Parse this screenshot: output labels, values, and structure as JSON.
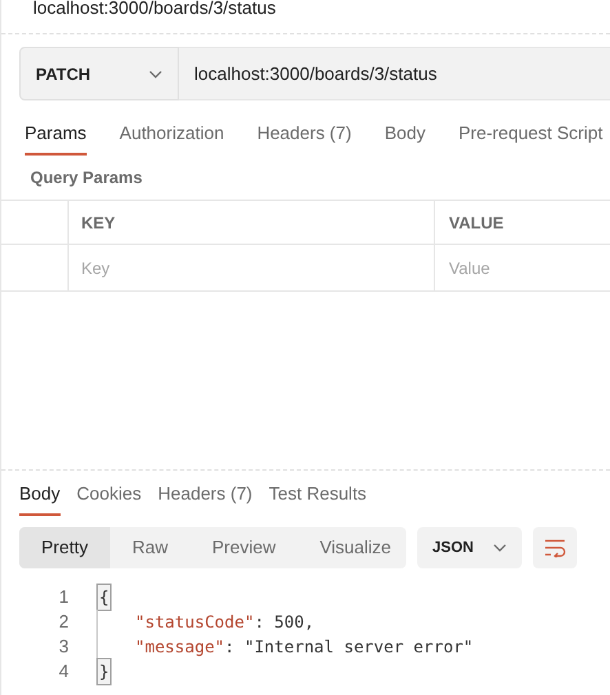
{
  "title": "localhost:3000/boards/3/status",
  "request": {
    "method": "PATCH",
    "url": "localhost:3000/boards/3/status"
  },
  "request_tabs": [
    {
      "label": "Params",
      "selected": true
    },
    {
      "label": "Authorization",
      "selected": false
    },
    {
      "label": "Headers (7)",
      "selected": false
    },
    {
      "label": "Body",
      "selected": false
    },
    {
      "label": "Pre-request Script",
      "selected": false
    }
  ],
  "query_params": {
    "heading": "Query Params",
    "columns": [
      "KEY",
      "VALUE"
    ],
    "placeholders": [
      "Key",
      "Value"
    ]
  },
  "response_tabs": [
    {
      "label": "Body",
      "selected": true
    },
    {
      "label": "Cookies",
      "selected": false
    },
    {
      "label": "Headers (7)",
      "selected": false
    },
    {
      "label": "Test Results",
      "selected": false
    }
  ],
  "view_modes": [
    {
      "label": "Pretty",
      "selected": true
    },
    {
      "label": "Raw",
      "selected": false
    },
    {
      "label": "Preview",
      "selected": false
    },
    {
      "label": "Visualize",
      "selected": false
    }
  ],
  "format": "JSON",
  "code_lines": [
    {
      "number": "1",
      "kind": "brace",
      "tokens": [
        {
          "kind": "punct",
          "text": "{"
        }
      ]
    },
    {
      "number": "2",
      "kind": "entry",
      "tokens": [
        {
          "kind": "key",
          "text": "\"statusCode\""
        },
        {
          "kind": "punct",
          "text": ": "
        },
        {
          "kind": "number",
          "text": "500"
        },
        {
          "kind": "punct",
          "text": ","
        }
      ]
    },
    {
      "number": "3",
      "kind": "entry",
      "tokens": [
        {
          "kind": "key",
          "text": "\"message\""
        },
        {
          "kind": "punct",
          "text": ": "
        },
        {
          "kind": "string",
          "text": "\"Internal server error\""
        }
      ]
    },
    {
      "number": "4",
      "kind": "brace",
      "tokens": [
        {
          "kind": "punct",
          "text": "}"
        }
      ]
    }
  ]
}
